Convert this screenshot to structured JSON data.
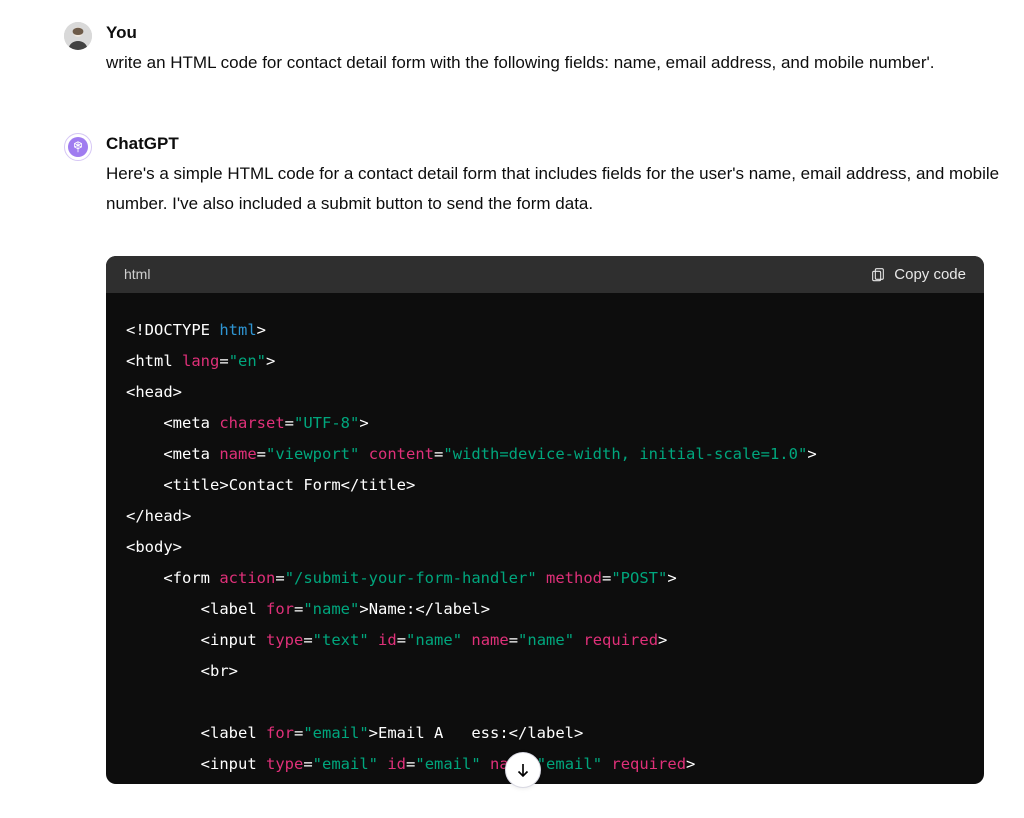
{
  "user": {
    "author": "You",
    "text": "write an HTML code for contact detail form with the following fields: name, email address, and mobile number'."
  },
  "assistant": {
    "author": "ChatGPT",
    "text": "Here's a simple HTML code for a contact detail form that includes fields for the user's name, email address, and mobile number. I've also included a submit button to send the form data."
  },
  "code": {
    "language_label": "html",
    "copy_label": "Copy code",
    "tokens": {
      "t00a": "<!",
      "t00b": "DOCTYPE ",
      "t00c": "html",
      "t00d": ">",
      "t01a": "<",
      "t01b": "html ",
      "t01c": "lang",
      "t01d": "=",
      "t01e": "\"en\"",
      "t01f": ">",
      "t02a": "<",
      "t02b": "head",
      "t02c": ">",
      "t03a": "<",
      "t03b": "meta ",
      "t03c": "charset",
      "t03d": "=",
      "t03e": "\"UTF-8\"",
      "t03f": ">",
      "t04a": "<",
      "t04b": "meta ",
      "t04c": "name",
      "t04d": "=",
      "t04e": "\"viewport\"",
      "t04f": " ",
      "t04g": "content",
      "t04h": "=",
      "t04i": "\"width=device-width, initial-scale=1.0\"",
      "t04j": ">",
      "t05a": "<",
      "t05b": "title",
      "t05c": ">",
      "t05d": "Contact Form",
      "t05e": "</",
      "t05f": "title",
      "t05g": ">",
      "t06a": "</",
      "t06b": "head",
      "t06c": ">",
      "t07a": "<",
      "t07b": "body",
      "t07c": ">",
      "t08a": "<",
      "t08b": "form ",
      "t08c": "action",
      "t08d": "=",
      "t08e": "\"/submit-your-form-handler\"",
      "t08f": " ",
      "t08g": "method",
      "t08h": "=",
      "t08i": "\"POST\"",
      "t08j": ">",
      "t09a": "<",
      "t09b": "label ",
      "t09c": "for",
      "t09d": "=",
      "t09e": "\"name\"",
      "t09f": ">",
      "t09g": "Name:",
      "t09h": "</",
      "t09i": "label",
      "t09j": ">",
      "t10a": "<",
      "t10b": "input ",
      "t10c": "type",
      "t10d": "=",
      "t10e": "\"text\"",
      "t10f": " ",
      "t10g": "id",
      "t10h": "=",
      "t10i": "\"name\"",
      "t10j": " ",
      "t10k": "name",
      "t10l": "=",
      "t10m": "\"name\"",
      "t10n": " ",
      "t10o": "required",
      "t10p": ">",
      "t11a": "<",
      "t11b": "br",
      "t11c": ">",
      "t12a": "<",
      "t12b": "label ",
      "t12c": "for",
      "t12d": "=",
      "t12e": "\"email\"",
      "t12f": ">",
      "t12g": "Email A",
      "t12gx": "ess:",
      "t12h": "</",
      "t12i": "label",
      "t12j": ">",
      "t13a": "<",
      "t13b": "input ",
      "t13c": "type",
      "t13d": "=",
      "t13e": "\"email\"",
      "t13f": " ",
      "t13g": "id",
      "t13h": "=",
      "t13i": "\"email\"",
      "t13j": " ",
      "t13k": "name",
      "t13l": "=",
      "t13m": "\"email\"",
      "t13n": " ",
      "t13o": "required",
      "t13p": ">"
    }
  }
}
